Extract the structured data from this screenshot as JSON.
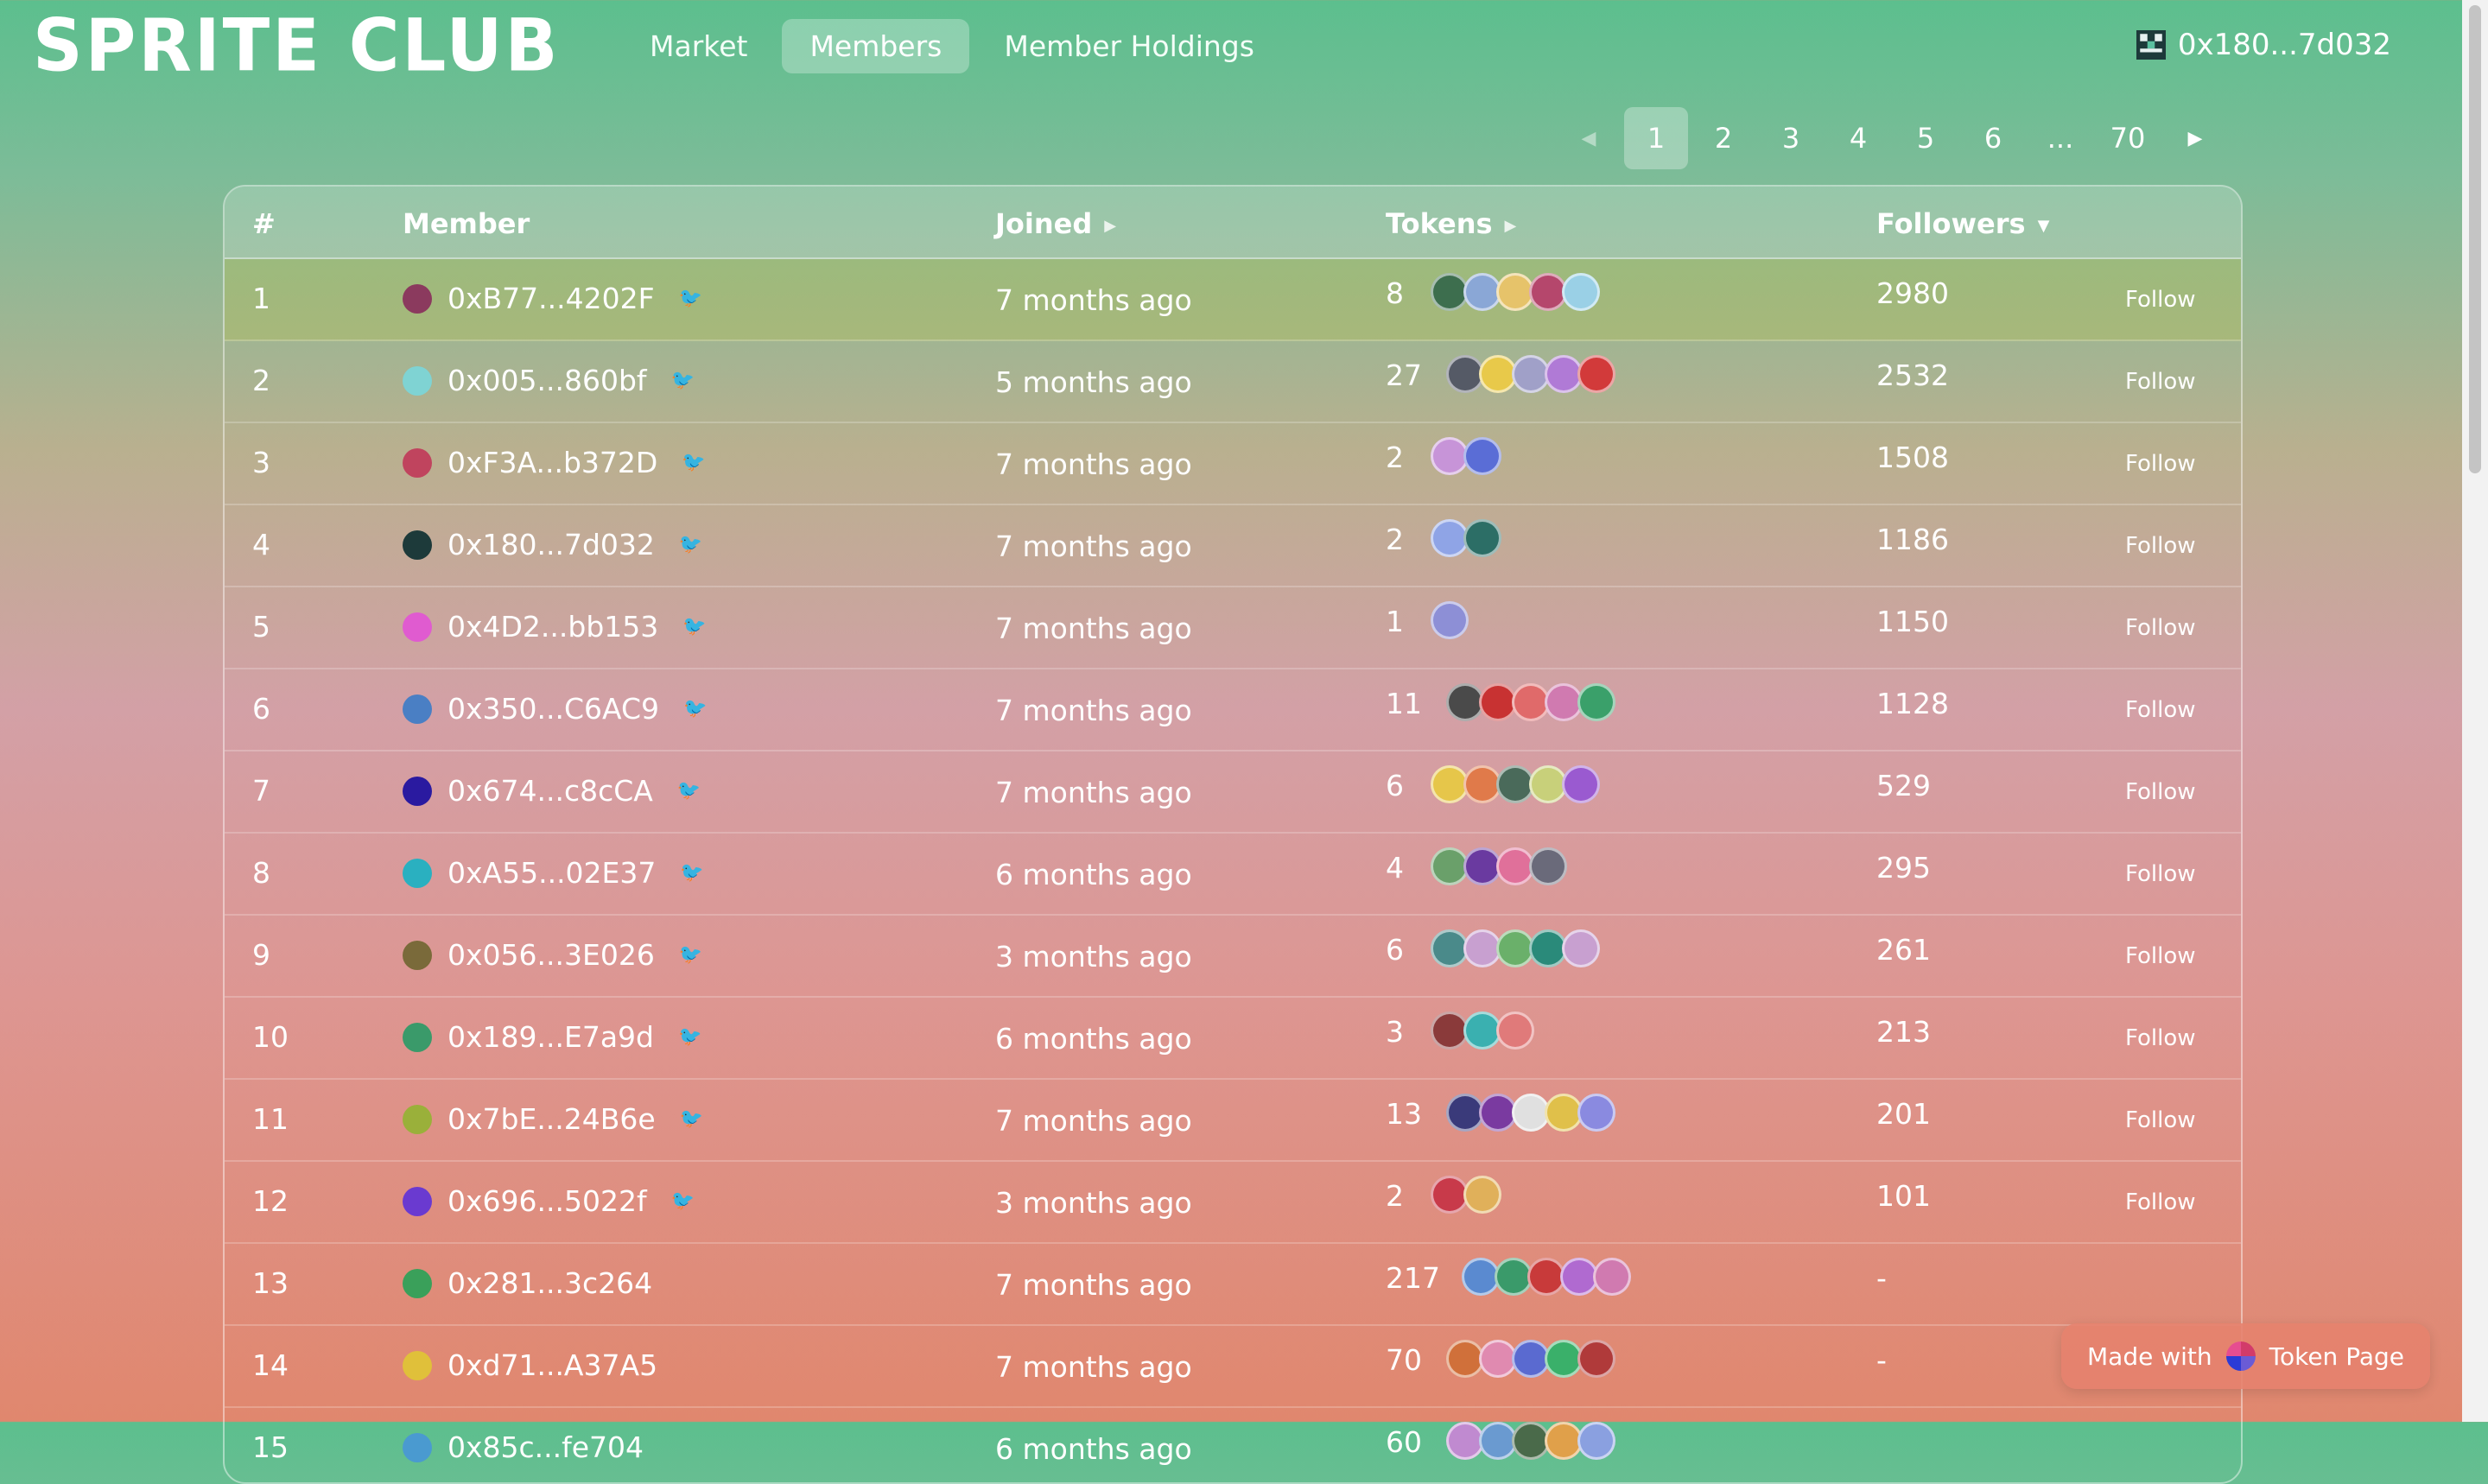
{
  "header": {
    "logo": "SPRITE CLUB",
    "nav": [
      {
        "label": "Market",
        "active": false
      },
      {
        "label": "Members",
        "active": true
      },
      {
        "label": "Member Holdings",
        "active": false
      }
    ],
    "wallet": "0x180...7d032"
  },
  "pagination": {
    "pages": [
      "1",
      "2",
      "3",
      "4",
      "5",
      "6",
      "...",
      "70"
    ],
    "current": "1"
  },
  "table": {
    "columns": {
      "rank": "#",
      "member": "Member",
      "joined": "Joined",
      "tokens": "Tokens",
      "followers": "Followers"
    },
    "follow_label": "Follow",
    "rows": [
      {
        "rank": "1",
        "member": "0xB77...4202F",
        "joined": "7 months ago",
        "tokens": "8",
        "followers": "2980",
        "twitter": true,
        "avatar": "#8b3a5e",
        "tok": [
          "#3d6e4e",
          "#8aa7d6",
          "#e6c36a",
          "#b5476c",
          "#9ad0e6"
        ]
      },
      {
        "rank": "2",
        "member": "0x005...860bf",
        "joined": "5 months ago",
        "tokens": "27",
        "followers": "2532",
        "twitter": true,
        "avatar": "#7fd3d3",
        "tok": [
          "#555a66",
          "#e8c94a",
          "#a0a0c8",
          "#b07ad6",
          "#d23a3a"
        ]
      },
      {
        "rank": "3",
        "member": "0xF3A...b372D",
        "joined": "7 months ago",
        "tokens": "2",
        "followers": "1508",
        "twitter": true,
        "avatar": "#c0445e",
        "tok": [
          "#c794d8",
          "#5a6dd6"
        ]
      },
      {
        "rank": "4",
        "member": "0x180...7d032",
        "joined": "7 months ago",
        "tokens": "2",
        "followers": "1186",
        "twitter": true,
        "avatar": "#1d3a3a",
        "tok": [
          "#8fa4e6",
          "#2c6e66"
        ]
      },
      {
        "rank": "5",
        "member": "0x4D2...bb153",
        "joined": "7 months ago",
        "tokens": "1",
        "followers": "1150",
        "twitter": true,
        "avatar": "#e05bd0",
        "tok": [
          "#8d8fd6"
        ]
      },
      {
        "rank": "6",
        "member": "0x350...C6AC9",
        "joined": "7 months ago",
        "tokens": "11",
        "followers": "1128",
        "twitter": true,
        "avatar": "#4a7fc4",
        "tok": [
          "#4a4a4a",
          "#c83232",
          "#e06a6a",
          "#d07ab0",
          "#3aa06a"
        ]
      },
      {
        "rank": "7",
        "member": "0x674...c8cCA",
        "joined": "7 months ago",
        "tokens": "6",
        "followers": "529",
        "twitter": true,
        "avatar": "#2a1aa0",
        "tok": [
          "#e6c64a",
          "#e07a4a",
          "#4a6a5a",
          "#c8d07a",
          "#9a5ad0"
        ]
      },
      {
        "rank": "8",
        "member": "0xA55...02E37",
        "joined": "6 months ago",
        "tokens": "4",
        "followers": "295",
        "twitter": true,
        "avatar": "#2ab0c0",
        "tok": [
          "#6aa06a",
          "#6a3aa0",
          "#e0709a",
          "#6a6a7a"
        ]
      },
      {
        "rank": "9",
        "member": "0x056...3E026",
        "joined": "3 months ago",
        "tokens": "6",
        "followers": "261",
        "twitter": true,
        "avatar": "#7a6a3a",
        "tok": [
          "#4a8a8a",
          "#c8a0d0",
          "#6ab06a",
          "#2a8a7a",
          "#c8a0d0"
        ]
      },
      {
        "rank": "10",
        "member": "0x189...E7a9d",
        "joined": "6 months ago",
        "tokens": "3",
        "followers": "213",
        "twitter": true,
        "avatar": "#3a9a6a",
        "tok": [
          "#8a3a3a",
          "#3ab0b0",
          "#e07a7a"
        ]
      },
      {
        "rank": "11",
        "member": "0x7bE...24B6e",
        "joined": "7 months ago",
        "tokens": "13",
        "followers": "201",
        "twitter": true,
        "avatar": "#9ab03a",
        "tok": [
          "#3a3a7a",
          "#7a3aa0",
          "#e0e0e0",
          "#e0c04a",
          "#8a8ae0"
        ]
      },
      {
        "rank": "12",
        "member": "0x696...5022f",
        "joined": "3 months ago",
        "tokens": "2",
        "followers": "101",
        "twitter": true,
        "avatar": "#6a3ad0",
        "tok": [
          "#c83a4a",
          "#e0b05a"
        ]
      },
      {
        "rank": "13",
        "member": "0x281...3c264",
        "joined": "7 months ago",
        "tokens": "217",
        "followers": "-",
        "twitter": false,
        "avatar": "#3aa05a",
        "tok": [
          "#5a8ad0",
          "#3a9a6a",
          "#c83a3a",
          "#b06ad0",
          "#d07ab0"
        ]
      },
      {
        "rank": "14",
        "member": "0xd71...A37A5",
        "joined": "7 months ago",
        "tokens": "70",
        "followers": "-",
        "twitter": false,
        "avatar": "#e0c03a",
        "tok": [
          "#d0703a",
          "#e08ab0",
          "#5a6ad0",
          "#3ab06a",
          "#b03a3a"
        ]
      },
      {
        "rank": "15",
        "member": "0x85c...fe704",
        "joined": "6 months ago",
        "tokens": "60",
        "followers": "",
        "twitter": false,
        "avatar": "#4a9ad0",
        "tok": [
          "#c08ad0",
          "#6a9ad0",
          "#4a6a4a",
          "#e0a04a",
          "#8aa0e0"
        ]
      }
    ]
  },
  "badge": {
    "prefix": "Made with",
    "brand": "Token Page"
  }
}
